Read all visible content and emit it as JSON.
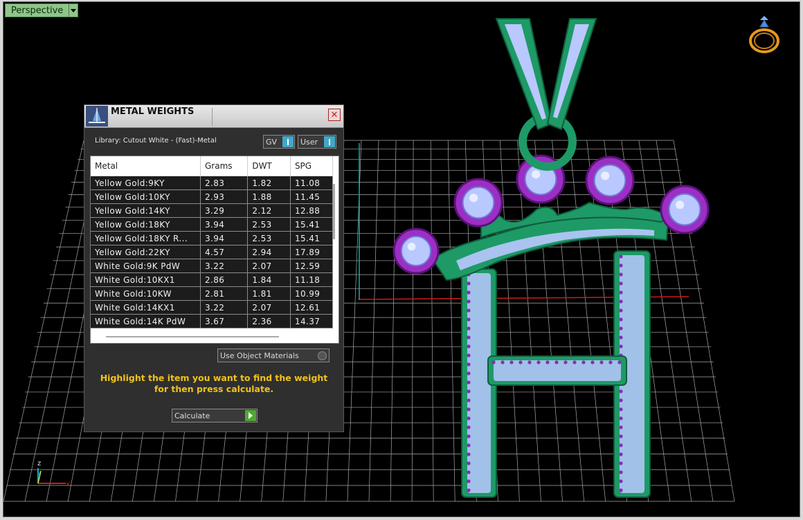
{
  "viewport": {
    "name": "Perspective",
    "axis": {
      "z": "z",
      "y": "y",
      "x": "x"
    },
    "colors": {
      "grid": "#c8c8c8",
      "x_axis": "#d11a1a",
      "y_axis": "#18a6b8",
      "metal": "#1e9a66",
      "stones": "#b9c8ff",
      "prongs": "#8a2bb8"
    },
    "icon": "ring-with-diamond-icon"
  },
  "panel": {
    "title": "METAL WEIGHTS",
    "library_label": "Library: Cutout White - (Fast)-Metal",
    "toggles": [
      {
        "label": "GV"
      },
      {
        "label": "User"
      }
    ],
    "columns": [
      "Metal",
      "Grams",
      "DWT",
      "SPG"
    ],
    "rows": [
      {
        "metal": "Yellow Gold:9KY",
        "grams": "2.83",
        "dwt": "1.82",
        "spg": "11.08"
      },
      {
        "metal": "Yellow Gold:10KY",
        "grams": "2.93",
        "dwt": "1.88",
        "spg": "11.45"
      },
      {
        "metal": "Yellow Gold:14KY",
        "grams": "3.29",
        "dwt": "2.12",
        "spg": "12.88"
      },
      {
        "metal": "Yellow Gold:18KY",
        "grams": "3.94",
        "dwt": "2.53",
        "spg": "15.41"
      },
      {
        "metal": "Yellow Gold:18KY R...",
        "grams": "3.94",
        "dwt": "2.53",
        "spg": "15.41"
      },
      {
        "metal": "Yellow Gold:22KY",
        "grams": "4.57",
        "dwt": "2.94",
        "spg": "17.89"
      },
      {
        "metal": "White Gold:9K PdW",
        "grams": "3.22",
        "dwt": "2.07",
        "spg": "12.59"
      },
      {
        "metal": "White Gold:10KX1",
        "grams": "2.86",
        "dwt": "1.84",
        "spg": "11.18"
      },
      {
        "metal": "White Gold:10KW",
        "grams": "2.81",
        "dwt": "1.81",
        "spg": "10.99"
      },
      {
        "metal": "White Gold:14KX1",
        "grams": "3.22",
        "dwt": "2.07",
        "spg": "12.61"
      },
      {
        "metal": "White Gold:14K PdW",
        "grams": "3.67",
        "dwt": "2.36",
        "spg": "14.37"
      }
    ],
    "use_object_materials": "Use Object Materials",
    "instruction": "Highlight the item you want to find the weight for then press calculate.",
    "calculate_label": "Calculate",
    "colors": {
      "instruction": "#f2c31a",
      "toggle": "#43a6c8",
      "calculate": "#4fa832"
    }
  }
}
